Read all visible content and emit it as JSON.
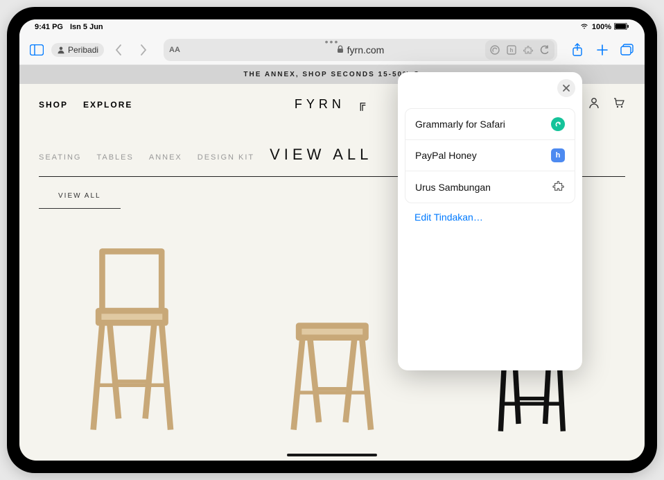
{
  "status_bar": {
    "time": "9:41 PG",
    "date": "Isn 5 Jun",
    "battery_text": "100%"
  },
  "toolbar": {
    "profile_label": "Peribadi",
    "url_domain": "fyrn.com"
  },
  "site": {
    "promo_text": "THE ANNEX, SHOP SECONDS 15-50% O",
    "nav": {
      "shop": "SHOP",
      "explore": "EXPLORE"
    },
    "brand": "FYRN",
    "categories": {
      "seating": "SEATING",
      "tables": "TABLES",
      "annex": "ANNEX",
      "design_kit": "DESIGN KIT",
      "view_all": "VIEW ALL"
    },
    "view_all_label": "VIEW ALL"
  },
  "popover": {
    "items": [
      {
        "label": "Grammarly for Safari",
        "icon": "grammarly",
        "color": "#15c39a"
      },
      {
        "label": "PayPal Honey",
        "icon": "honey",
        "color": "#4d8af0"
      },
      {
        "label": "Urus Sambungan",
        "icon": "puzzle",
        "color": "#555"
      }
    ],
    "edit_label": "Edit Tindakan…"
  }
}
